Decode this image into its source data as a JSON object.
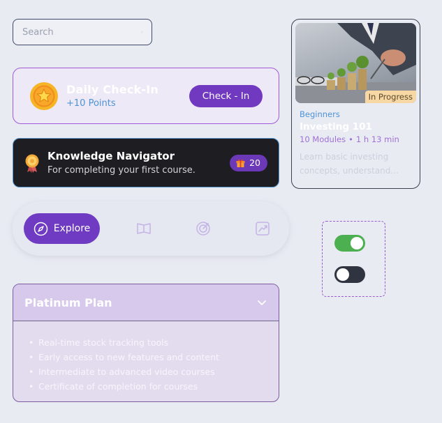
{
  "search": {
    "placeholder": "Search"
  },
  "checkin": {
    "title": "Daily Check-In",
    "points": "+10 Points",
    "button_label": "Check - In"
  },
  "achievement": {
    "title": "Knowledge Navigator",
    "description": "For completing your first course.",
    "reward_count": "20"
  },
  "navbar": {
    "active_label": "Explore",
    "items": [
      "compass-icon",
      "book-icon",
      "target-icon",
      "chart-icon"
    ]
  },
  "plan": {
    "title": "Platinum Plan",
    "bullet": "•",
    "features": [
      "Real-time stock tracking tools",
      "Early access to new features and content",
      "Intermediate to advanced video courses",
      "Certificate of completion for courses"
    ]
  },
  "course": {
    "status": "In Progress",
    "level": "Beginners",
    "title": "Investing 101",
    "modules": "10 Modules",
    "separator": "•",
    "duration": "1 h 13 min",
    "description": "Learn basic investing concepts, understand..."
  },
  "toggles": {
    "first_on": true,
    "second_on": false
  },
  "colors": {
    "accent": "#7138c0",
    "link": "#4d93d6",
    "toggle_on": "#4caf50",
    "toggle_off": "#2f3440",
    "status_badge": "#f7d7a3"
  }
}
